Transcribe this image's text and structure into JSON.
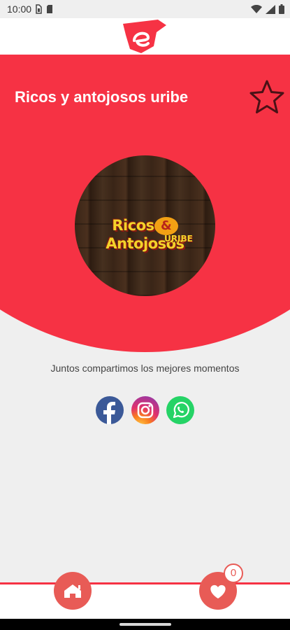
{
  "status_bar": {
    "time": "10:00",
    "left_icons": [
      "sim-icon",
      "sd-card-icon"
    ],
    "right_icons": [
      "wifi-icon",
      "signal-icon",
      "battery-icon"
    ]
  },
  "header": {
    "logo_icon": "app-logo-icon",
    "brand_color": "#f63244"
  },
  "store": {
    "title": "Ricos y antojosos uribe",
    "favorite_icon": "star-outline-icon",
    "logo": {
      "line1_left": "Ricos",
      "amp": "&",
      "line1_right": "Antojosos",
      "line2": "URIBE"
    },
    "tagline": "Juntos compartimos los mejores momentos"
  },
  "social": [
    {
      "name": "facebook",
      "icon": "facebook-icon"
    },
    {
      "name": "instagram",
      "icon": "instagram-icon"
    },
    {
      "name": "whatsapp",
      "icon": "whatsapp-icon"
    }
  ],
  "bottom_nav": {
    "home_icon": "home-icon",
    "favorites_icon": "heart-icon",
    "favorites_count": "0"
  }
}
